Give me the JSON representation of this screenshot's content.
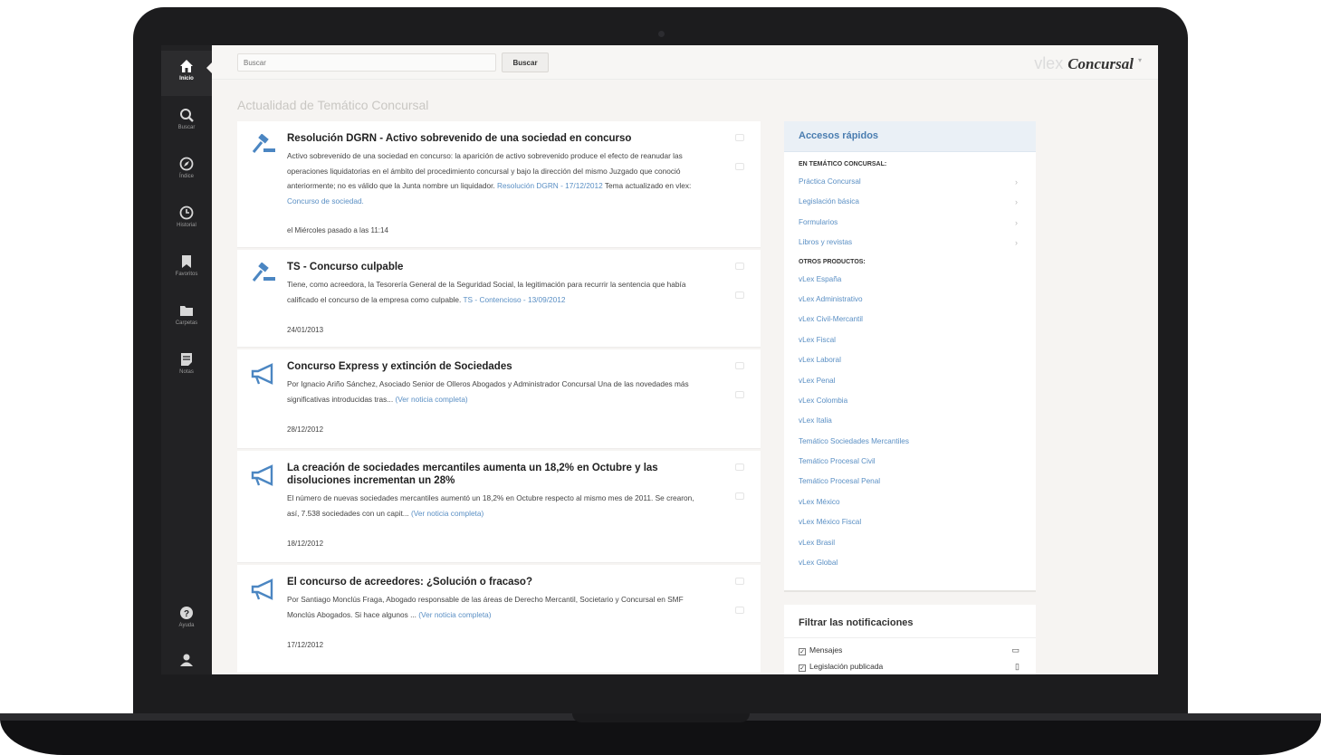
{
  "sidebar": {
    "items": [
      {
        "label": "Inicio",
        "icon": "home-icon"
      },
      {
        "label": "Buscar",
        "icon": "search-icon"
      },
      {
        "label": "Índice",
        "icon": "compass-icon"
      },
      {
        "label": "Historial",
        "icon": "history-icon"
      },
      {
        "label": "Favoritos",
        "icon": "bookmark-icon"
      },
      {
        "label": "Carpetas",
        "icon": "folder-icon"
      },
      {
        "label": "Notas",
        "icon": "notes-icon"
      }
    ],
    "bottom": [
      {
        "label": "Ayuda",
        "icon": "help-icon"
      },
      {
        "label": "",
        "icon": "user-icon"
      }
    ]
  },
  "topbar": {
    "search_placeholder": "Buscar",
    "search_button": "Buscar",
    "brand_vlex": "vlex",
    "brand_product": "Concursal"
  },
  "page_title": "Actualidad de Temático Concursal",
  "news": [
    {
      "title": "Resolución DGRN - Activo sobrevenido de una sociedad en concurso",
      "icon": "gavel-icon",
      "body": "Activo sobrevenido de una sociedad en concurso: la aparición de activo sobrevenido produce el efecto de reanudar las operaciones liquidatorias en el ámbito del procedimiento concursal y bajo la dirección del mismo Juzgado que conoció anteriormente; no es válido que la Junta nombre un liquidador.",
      "link": "Resolución DGRN - 17/12/2012",
      "extra": " Tema actualizado en vlex: ",
      "extra_link": "Concurso de sociedad.",
      "date": "el Miércoles pasado a las 11:14"
    },
    {
      "title": "TS - Concurso culpable",
      "icon": "gavel-icon",
      "body": "Tiene, como acreedora, la Tesorería General de la Seguridad Social, la legitimación para recurrir la sentencia que había calificado el concurso de la empresa como culpable.",
      "link": "TS - Contencioso - 13/09/2012",
      "date": "24/01/2013"
    },
    {
      "title": "Concurso Express y extinción de Sociedades",
      "icon": "megaphone-icon",
      "body": "Por Ignacio Ariño Sánchez, Asociado Senior de Olleros Abogados y Administrador Concursal Una de las novedades más significativas introducidas tras...",
      "link": "(Ver noticia completa)",
      "date": "28/12/2012"
    },
    {
      "title": "La creación de sociedades mercantiles aumenta un 18,2% en Octubre y las disoluciones incrementan un 28%",
      "icon": "megaphone-icon",
      "body": "El número de nuevas sociedades mercantiles aumentó un 18,2% en Octubre respecto al mismo mes de 2011. Se crearon, así, 7.538 sociedades con un capit...",
      "link": "(Ver noticia completa)",
      "date": "18/12/2012"
    },
    {
      "title": "El concurso de acreedores: ¿Solución o fracaso?",
      "icon": "megaphone-icon",
      "body": "Por Santiago Monclús Fraga, Abogado responsable de las áreas de Derecho Mercantil, Societario y Concursal en SMF Monclús Abogados. Si hace algunos ...",
      "link": "(Ver noticia completa)",
      "date": "17/12/2012"
    }
  ],
  "quick_access": {
    "title": "Accesos rápidos",
    "section1": "EN TEMÁTICO CONCURSAL:",
    "section1_items": [
      "Práctica Concursal",
      "Legislación básica",
      "Formularios",
      "Libros y revistas"
    ],
    "section2": "OTROS PRODUCTOS:",
    "section2_items": [
      "vLex España",
      "vLex Administrativo",
      "vLex Civil-Mercantil",
      "vLex Fiscal",
      "vLex Laboral",
      "vLex Penal",
      "vLex Colombia",
      "vLex Italia",
      "Temático Sociedades Mercantiles",
      "Temático Procesal Civil",
      "Temático Procesal Penal",
      "vLex México",
      "vLex México Fiscal",
      "vLex Brasil",
      "vLex Global"
    ]
  },
  "filter": {
    "title": "Filtrar las notificaciones",
    "items": [
      {
        "label": "Mensajes",
        "checked": true,
        "icon": "message-icon"
      },
      {
        "label": "Legislación publicada",
        "checked": true,
        "icon": "document-icon"
      }
    ]
  }
}
